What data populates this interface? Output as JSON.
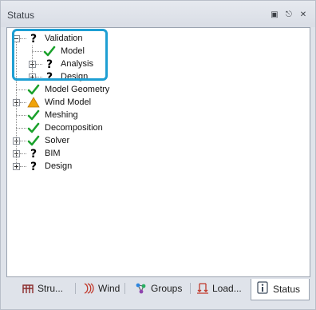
{
  "panel": {
    "title": "Status",
    "window_icons": [
      "restore-icon",
      "pin-icon",
      "close-icon"
    ]
  },
  "colors": {
    "highlight": "#1e9fd3",
    "ok": "#1aa12b",
    "warning": "#f0a30a",
    "unknown": "#000000"
  },
  "tree": [
    {
      "label": "Validation",
      "status": "unknown",
      "expander": "minus",
      "level": 0
    },
    {
      "label": "Model",
      "status": "ok",
      "expander": "none",
      "level": 1
    },
    {
      "label": "Analysis",
      "status": "unknown",
      "expander": "plus",
      "level": 1
    },
    {
      "label": "Design",
      "status": "unknown",
      "expander": "plus",
      "level": 1
    },
    {
      "label": "Model Geometry",
      "status": "ok",
      "expander": "none",
      "level": 0
    },
    {
      "label": "Wind Model",
      "status": "warning",
      "expander": "plus",
      "level": 0
    },
    {
      "label": "Meshing",
      "status": "ok",
      "expander": "none",
      "level": 0
    },
    {
      "label": "Decomposition",
      "status": "ok",
      "expander": "none",
      "level": 0
    },
    {
      "label": "Solver",
      "status": "ok",
      "expander": "plus",
      "level": 0
    },
    {
      "label": "BIM",
      "status": "unknown",
      "expander": "plus",
      "level": 0
    },
    {
      "label": "Design",
      "status": "unknown",
      "expander": "plus",
      "level": 0
    }
  ],
  "tabs": [
    {
      "label": "Stru...",
      "icon": "structure-icon",
      "active": false
    },
    {
      "label": "Wind",
      "icon": "wind-icon",
      "active": false
    },
    {
      "label": "Groups",
      "icon": "groups-icon",
      "active": false
    },
    {
      "label": "Load...",
      "icon": "loads-icon",
      "active": false
    },
    {
      "label": "Status",
      "icon": "status-info-icon",
      "active": true
    }
  ]
}
